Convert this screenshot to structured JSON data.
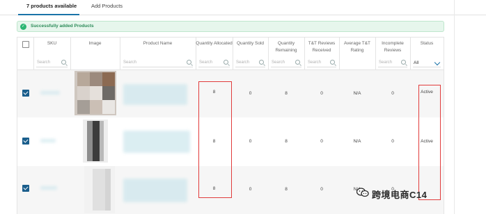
{
  "tabs": [
    {
      "label": "7 products available",
      "active": true
    },
    {
      "label": "Add Products",
      "active": false
    }
  ],
  "alert": {
    "text": "Successfully added Products",
    "icon": "check-circle-icon",
    "color": "#2bb673"
  },
  "columns": {
    "sku": "SKU",
    "image": "Image",
    "product_name": "Product Name",
    "qty_allocated": "Quantity Allocated",
    "qty_sold": "Quantity Sold",
    "qty_remaining": "Quantity Remaining",
    "tt_reviews": "T&T Reviews Received",
    "avg_rating": "Average T&T Rating",
    "incomplete_reviews": "Incomplete Reviews",
    "status": "Status"
  },
  "filters": {
    "placeholder": "Search",
    "status_value": "All"
  },
  "rows": [
    {
      "qty_allocated": "8",
      "qty_sold": "0",
      "qty_remaining": "8",
      "tt_reviews": "0",
      "avg_rating": "N/A",
      "incomplete_reviews": "0",
      "status": "Active"
    },
    {
      "qty_allocated": "8",
      "qty_sold": "0",
      "qty_remaining": "8",
      "tt_reviews": "0",
      "avg_rating": "N/A",
      "incomplete_reviews": "0",
      "status": "Active"
    },
    {
      "qty_allocated": "8",
      "qty_sold": "0",
      "qty_remaining": "8",
      "tt_reviews": "0",
      "avg_rating": "N/A",
      "incomplete_reviews": "0",
      "status": ""
    }
  ],
  "watermark": {
    "text": "跨境电商C14"
  },
  "colors": {
    "accent": "#1a73a8",
    "checkbox": "#1a5e8c",
    "highlight": "#e13b3b",
    "success_bg": "#e6f6ec"
  }
}
